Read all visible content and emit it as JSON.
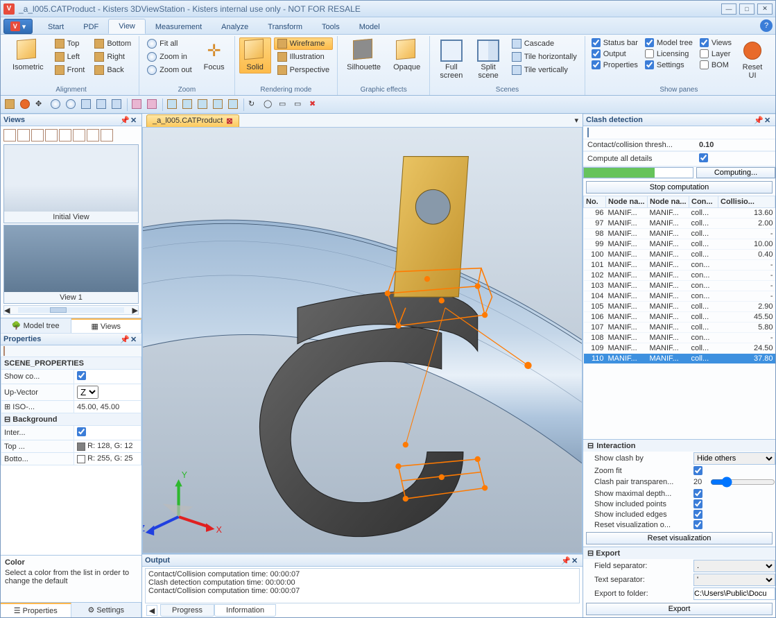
{
  "app": {
    "title": "_a_l005.CATProduct - Kisters 3DViewStation - Kisters internal use only - NOT FOR RESALE"
  },
  "ribbon": {
    "tabs": [
      "Start",
      "PDF",
      "View",
      "Measurement",
      "Analyze",
      "Transform",
      "Tools",
      "Model"
    ],
    "active_tab": "View",
    "groups": {
      "alignment": {
        "label": "Alignment",
        "isometric": "Isometric",
        "top": "Top",
        "left": "Left",
        "front": "Front",
        "bottom": "Bottom",
        "right": "Right",
        "back": "Back"
      },
      "zoom": {
        "label": "Zoom",
        "fitall": "Fit all",
        "zoomin": "Zoom in",
        "zoomout": "Zoom out",
        "focus": "Focus"
      },
      "render": {
        "label": "Rendering mode",
        "solid": "Solid",
        "wireframe": "Wireframe",
        "illustration": "Illustration",
        "perspective": "Perspective"
      },
      "graphic": {
        "label": "Graphic effects",
        "silhouette": "Silhouette",
        "opaque": "Opaque"
      },
      "scenes": {
        "label": "Scenes",
        "full": "Full screen",
        "split": "Split scene",
        "cascade": "Cascade",
        "tileh": "Tile horizontally",
        "tilev": "Tile vertically"
      },
      "panes": {
        "label": "Show panes",
        "statusbar": "Status bar",
        "output": "Output",
        "properties": "Properties",
        "modeltree": "Model tree",
        "licensing": "Licensing",
        "settings": "Settings",
        "views": "Views",
        "layer": "Layer",
        "bom": "BOM",
        "reset": "Reset UI"
      }
    }
  },
  "views_panel": {
    "title": "Views",
    "initial": "Initial View",
    "view1": "View 1",
    "tab_modeltree": "Model tree",
    "tab_views": "Views"
  },
  "properties": {
    "title": "Properties",
    "scene_section": "SCENE_PROPERTIES",
    "show_coord": "Show co...",
    "upvector_label": "Up-Vector",
    "upvector_value": "Z",
    "iso": "ISO-...",
    "iso_value": "45.00, 45.00",
    "background_section": "Background",
    "inter": "Inter...",
    "top": "Top ...",
    "top_value": "R: 128, G: 12",
    "bottom": "Botto...",
    "bottom_value": "R: 255, G: 25",
    "help_title": "Color",
    "help_text": "Select a color from the list in order to change the default",
    "tab_properties": "Properties",
    "tab_settings": "Settings"
  },
  "document": {
    "tab": "_a_l005.CATProduct"
  },
  "output": {
    "title": "Output",
    "lines": [
      "Contact/Collision computation time: 00:00:07",
      "Clash detection computation time: 00:00:00",
      "Contact/Collision computation time: 00:00:07"
    ],
    "tab_progress": "Progress",
    "tab_info": "Information"
  },
  "clash": {
    "title": "Clash detection",
    "threshold_label": "Contact/collision thresh...",
    "threshold_value": "0.10",
    "compute_label": "Compute all details",
    "computing": "Computing...",
    "stop": "Stop computation",
    "headers": {
      "no": "No.",
      "na": "Node na...",
      "nb": "Node na...",
      "con": "Con...",
      "col": "Collisio..."
    },
    "rows": [
      {
        "no": "96",
        "a": "MANIF...",
        "b": "MANIF...",
        "c": "coll...",
        "v": "13.60"
      },
      {
        "no": "97",
        "a": "MANIF...",
        "b": "MANIF...",
        "c": "coll...",
        "v": "2.00"
      },
      {
        "no": "98",
        "a": "MANIF...",
        "b": "MANIF...",
        "c": "coll...",
        "v": "-"
      },
      {
        "no": "99",
        "a": "MANIF...",
        "b": "MANIF...",
        "c": "coll...",
        "v": "10.00"
      },
      {
        "no": "100",
        "a": "MANIF...",
        "b": "MANIF...",
        "c": "coll...",
        "v": "0.40"
      },
      {
        "no": "101",
        "a": "MANIF...",
        "b": "MANIF...",
        "c": "con...",
        "v": "-"
      },
      {
        "no": "102",
        "a": "MANIF...",
        "b": "MANIF...",
        "c": "con...",
        "v": "-"
      },
      {
        "no": "103",
        "a": "MANIF...",
        "b": "MANIF...",
        "c": "con...",
        "v": "-"
      },
      {
        "no": "104",
        "a": "MANIF...",
        "b": "MANIF...",
        "c": "con...",
        "v": "-"
      },
      {
        "no": "105",
        "a": "MANIF...",
        "b": "MANIF...",
        "c": "coll...",
        "v": "2.90"
      },
      {
        "no": "106",
        "a": "MANIF...",
        "b": "MANIF...",
        "c": "coll...",
        "v": "45.50"
      },
      {
        "no": "107",
        "a": "MANIF...",
        "b": "MANIF...",
        "c": "coll...",
        "v": "5.80"
      },
      {
        "no": "108",
        "a": "MANIF...",
        "b": "MANIF...",
        "c": "con...",
        "v": "-"
      },
      {
        "no": "109",
        "a": "MANIF...",
        "b": "MANIF...",
        "c": "coll...",
        "v": "24.50"
      },
      {
        "no": "110",
        "a": "MANIF...",
        "b": "MANIF...",
        "c": "coll...",
        "v": "37.80"
      }
    ],
    "interaction": {
      "title": "Interaction",
      "show_by": "Show clash by",
      "show_by_value": "Hide others",
      "zoomfit": "Zoom fit",
      "transp": "Clash pair transparen...",
      "transp_value": "20",
      "maxdepth": "Show maximal depth...",
      "incpoints": "Show included points",
      "incedges": "Show included edges",
      "resetvis": "Reset visualization o...",
      "resetbtn": "Reset visualization"
    },
    "export": {
      "title": "Export",
      "fieldsep": "Field separator:",
      "fieldsep_value": ".",
      "textsep": "Text separator:",
      "textsep_value": "'",
      "folder": "Export to folder:",
      "folder_value": "C:\\Users\\Public\\Docu",
      "exportbtn": "Export"
    }
  }
}
